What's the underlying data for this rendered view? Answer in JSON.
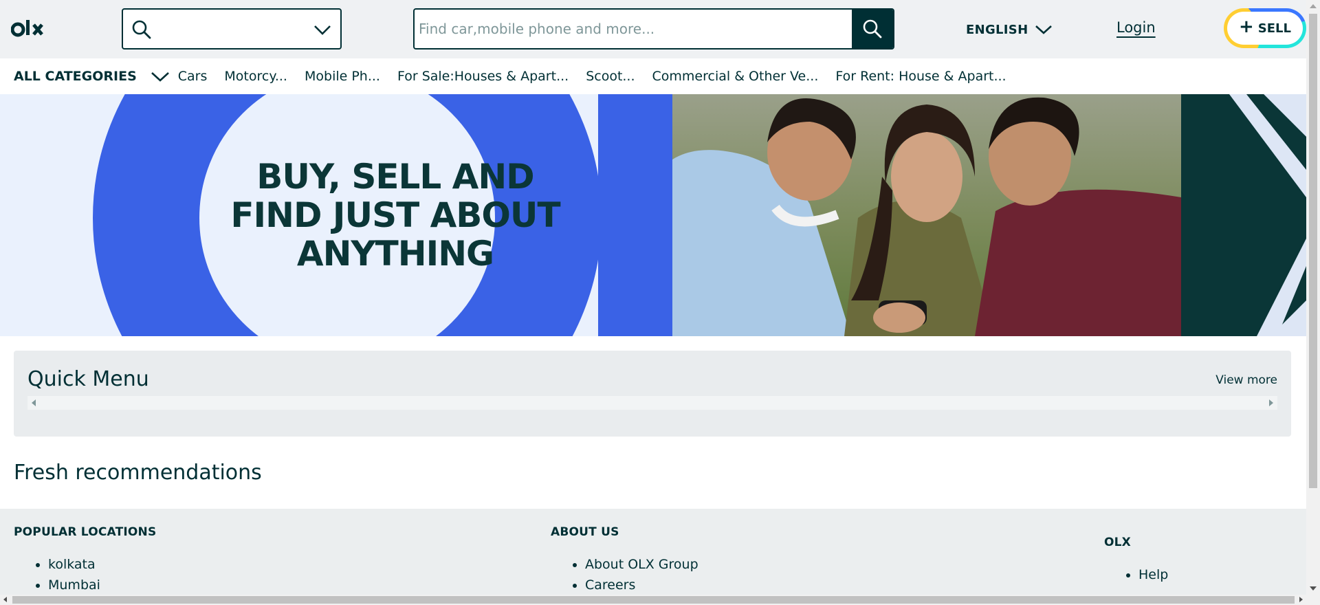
{
  "header": {
    "logo_text": "olx",
    "location_value": "",
    "search_placeholder": "Find car,mobile phone and more...",
    "language": "ENGLISH",
    "login_label": "Login",
    "sell_label": "SELL",
    "sell_plus": "+"
  },
  "categories": {
    "all_label": "ALL CATEGORIES",
    "items": [
      "Cars",
      "Motorcy...",
      "Mobile Ph...",
      "For Sale:Houses & Apart...",
      "Scoot...",
      "Commercial & Other Ve...",
      "For Rent: House & Apart..."
    ]
  },
  "banner": {
    "headline_line1": "BUY, SELL AND",
    "headline_line2": "FIND JUST ABOUT",
    "headline_line3": "ANYTHING"
  },
  "quick_menu": {
    "title": "Quick Menu",
    "view_more": "View more"
  },
  "fresh": {
    "title": "Fresh recommendations"
  },
  "footer": {
    "popular": {
      "heading": "POPULAR LOCATIONS",
      "items": [
        "kolkata",
        "Mumbai"
      ]
    },
    "about": {
      "heading": "ABOUT US",
      "items": [
        "About OLX Group",
        "Careers"
      ]
    },
    "olx": {
      "heading": "OLX",
      "items": [
        "Help"
      ]
    }
  },
  "colors": {
    "brand_dark": "#002f34",
    "banner_blue": "#3a62e6",
    "banner_light": "#eaf1fd",
    "sell_yellow": "#ffce32",
    "sell_blue": "#3a77ff",
    "sell_teal": "#23e5db"
  }
}
